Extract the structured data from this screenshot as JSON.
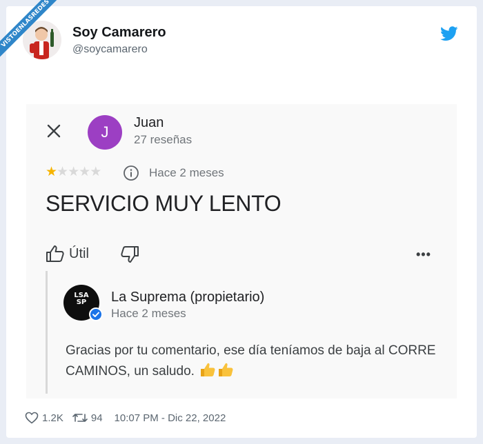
{
  "watermark": "VISTOENLASREDES",
  "tweet": {
    "author_name": "Soy Camarero",
    "author_handle": "@soycamarero",
    "likes": "1.2K",
    "retweets": "94",
    "timestamp": "10:07 PM - Dic 22, 2022"
  },
  "review": {
    "reviewer_initial": "J",
    "reviewer_name": "Juan",
    "reviewer_reviews": "27 reseñas",
    "rating": 1,
    "rating_max": 5,
    "time_ago": "Hace 2 meses",
    "text": "SERVICIO MUY LENTO",
    "useful_label": "Útil",
    "more_label": "•••"
  },
  "owner_reply": {
    "name": "La Suprema (propietario)",
    "time_ago": "Hace 2 meses",
    "logo_text": "LSA SP",
    "text": "Gracias por tu comentario, ese día teníamos de baja al CORRE CAMINOS, un saludo."
  },
  "colors": {
    "twitter_blue": "#1da1f2",
    "reviewer_avatar": "#9c3fc3",
    "star_gold": "#f6b400",
    "watermark_blue": "#2f86c9"
  }
}
